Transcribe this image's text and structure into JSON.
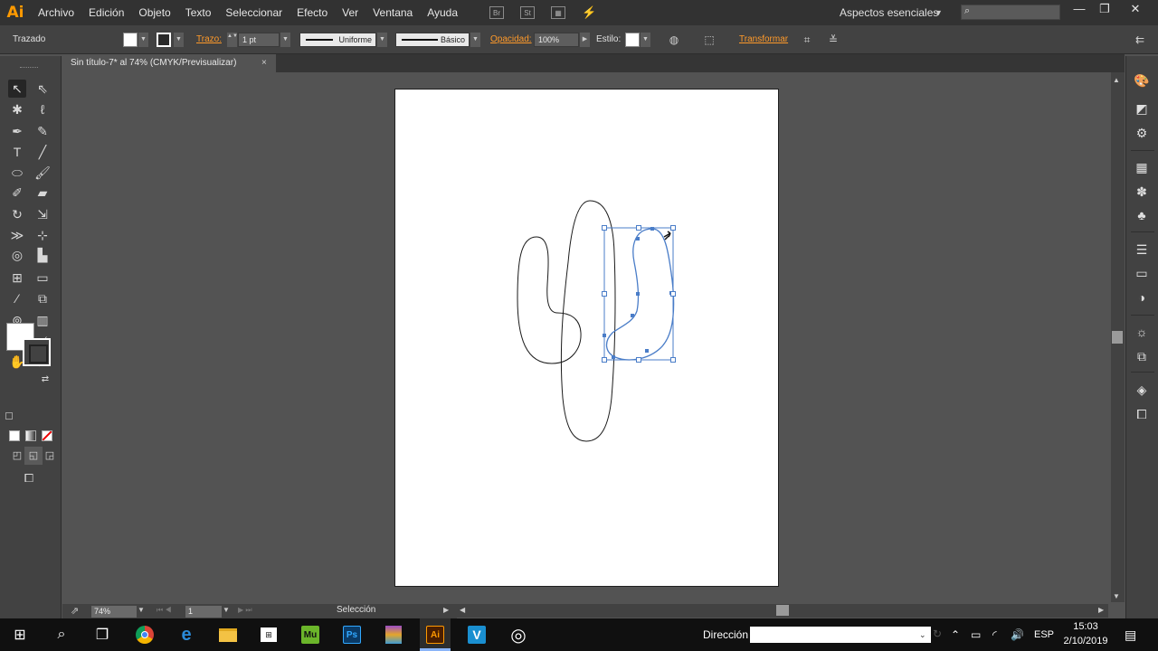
{
  "app": {
    "logo": "Ai"
  },
  "menu": [
    "Archivo",
    "Edición",
    "Objeto",
    "Texto",
    "Seleccionar",
    "Efecto",
    "Ver",
    "Ventana",
    "Ayuda"
  ],
  "menubar_icons": {
    "bridge": "Br",
    "stock": "St"
  },
  "workspace": {
    "label": "Aspectos esenciales"
  },
  "window_controls": {
    "minimize": "—",
    "restore": "❐",
    "close": "✕"
  },
  "control_bar": {
    "object_type": "Trazado",
    "stroke_label": "Trazo:",
    "stroke_weight": "1 pt",
    "profile": "Uniforme",
    "brush": "Básico",
    "opacity_label": "Opacidad:",
    "opacity_value": "100%",
    "style_label": "Estilo:",
    "transform_label": "Transformar"
  },
  "document": {
    "tab_title": "Sin título-7* al 74% (CMYK/Previsualizar)",
    "close": "×"
  },
  "status_bar": {
    "zoom": "74%",
    "page": "1",
    "tool": "Selección"
  },
  "colors": {
    "fill": "#ffffff",
    "stroke": "#000000",
    "selection": "#4a7dc8",
    "accent": "#ff9a00"
  },
  "taskbar": {
    "apps": [
      {
        "name": "Muse",
        "label": "Mu",
        "color": "#6bb52a"
      },
      {
        "name": "Photoshop",
        "label": "Ps",
        "color": "#0a3a66"
      },
      {
        "name": "Illustrator",
        "label": "Ai",
        "color": "#4a1e00"
      },
      {
        "name": "Visual",
        "label": "V",
        "color": "#1a8fd0"
      }
    ],
    "address_label": "Dirección",
    "language": "ESP",
    "time": "15:03",
    "date": "2/10/2019"
  }
}
